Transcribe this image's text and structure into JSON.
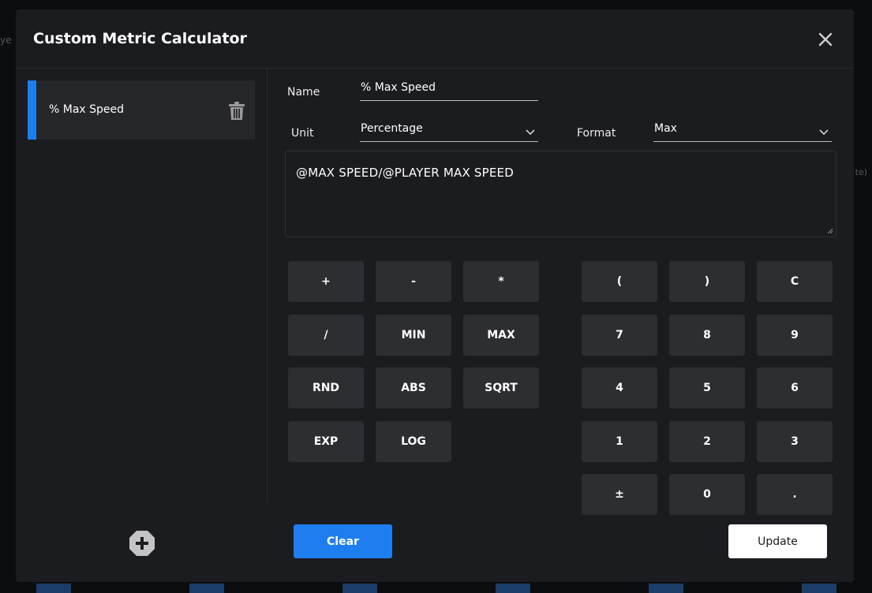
{
  "background": {
    "left_text": "ye",
    "right_text": "te)"
  },
  "modal": {
    "title": "Custom Metric Calculator",
    "close_icon": "close-icon"
  },
  "sidebar": {
    "items": [
      {
        "label": "% Max Speed",
        "accent_color": "#1e7ef0",
        "delete_icon": "trash-icon"
      }
    ],
    "add_icon": "add-circle-icon"
  },
  "form": {
    "name_label": "Name",
    "name_value": "% Max Speed",
    "unit_label": "Unit",
    "unit_value": "Percentage",
    "format_label": "Format",
    "format_value": "Max",
    "formula": "@MAX SPEED/@PLAYER MAX SPEED"
  },
  "keypad": {
    "operators": [
      "+",
      "-",
      "*",
      "/",
      "MIN",
      "MAX",
      "RND",
      "ABS",
      "SQRT",
      "EXP",
      "LOG"
    ],
    "numbers": [
      "(",
      ")",
      "C",
      "7",
      "8",
      "9",
      "4",
      "5",
      "6",
      "1",
      "2",
      "3",
      "±",
      "0",
      "."
    ]
  },
  "actions": {
    "clear_label": "Clear",
    "update_label": "Update"
  },
  "colors": {
    "accent": "#1e7ef0",
    "modal_bg": "#1b1c1f",
    "key_bg": "#2d2e32"
  }
}
